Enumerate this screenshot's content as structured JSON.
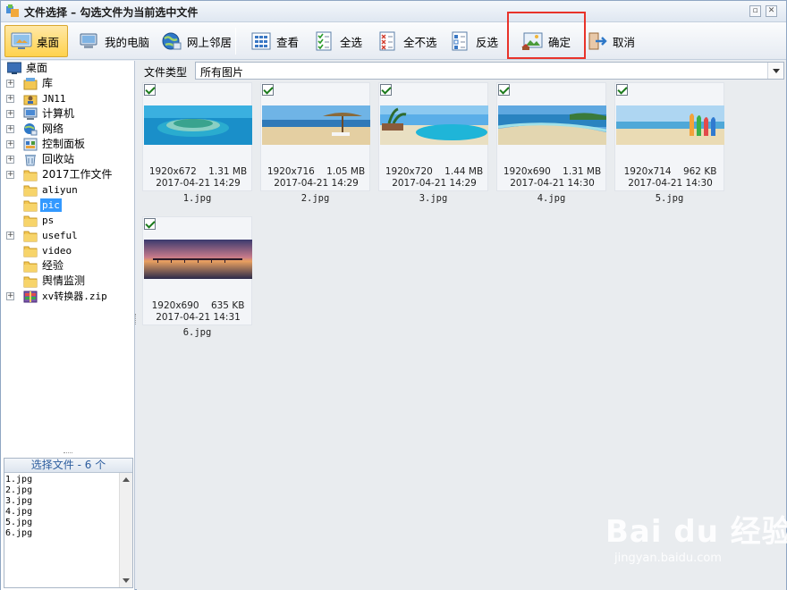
{
  "window": {
    "title": "文件选择 – 勾选文件为当前选中文件"
  },
  "toolbar": {
    "desktop": "桌面",
    "my_computer": "我的电脑",
    "network": "网上邻居",
    "view": "查看",
    "select_all": "全选",
    "select_none": "全不选",
    "invert": "反选",
    "confirm": "确定",
    "cancel": "取消"
  },
  "tree": {
    "root": "桌面",
    "items": [
      {
        "label": "库",
        "expandable": true,
        "icon": "library-icon"
      },
      {
        "label": "JN11",
        "expandable": true,
        "icon": "user-folder-icon"
      },
      {
        "label": "计算机",
        "expandable": true,
        "icon": "computer-icon"
      },
      {
        "label": "网络",
        "expandable": true,
        "icon": "network-icon"
      },
      {
        "label": "控制面板",
        "expandable": true,
        "icon": "control-panel-icon"
      },
      {
        "label": "回收站",
        "expandable": true,
        "icon": "recycle-bin-icon"
      },
      {
        "label": "2017工作文件",
        "expandable": true,
        "icon": "folder-icon"
      },
      {
        "label": "aliyun",
        "expandable": false,
        "icon": "folder-icon"
      },
      {
        "label": "pic",
        "expandable": false,
        "icon": "folder-icon",
        "selected": true
      },
      {
        "label": "ps",
        "expandable": false,
        "icon": "folder-icon"
      },
      {
        "label": "useful",
        "expandable": true,
        "icon": "folder-icon"
      },
      {
        "label": "video",
        "expandable": false,
        "icon": "folder-icon"
      },
      {
        "label": "经验",
        "expandable": false,
        "icon": "folder-icon"
      },
      {
        "label": "舆情监测",
        "expandable": false,
        "icon": "folder-icon"
      },
      {
        "label": "xv转换器.zip",
        "expandable": true,
        "icon": "zip-icon"
      }
    ]
  },
  "selection": {
    "header": "选择文件 - 6 个",
    "files": [
      "1.jpg",
      "2.jpg",
      "3.jpg",
      "4.jpg",
      "5.jpg",
      "6.jpg"
    ]
  },
  "filter": {
    "label": "文件类型",
    "value": "所有图片"
  },
  "files": [
    {
      "name": "1.jpg",
      "dims": "1920x672",
      "size": "1.31 MB",
      "date": "2017-04-21 14:29",
      "checked": true,
      "scene": "island"
    },
    {
      "name": "2.jpg",
      "dims": "1920x716",
      "size": "1.05 MB",
      "date": "2017-04-21 14:29",
      "checked": true,
      "scene": "umbrella"
    },
    {
      "name": "3.jpg",
      "dims": "1920x720",
      "size": "1.44 MB",
      "date": "2017-04-21 14:29",
      "checked": true,
      "scene": "pool"
    },
    {
      "name": "4.jpg",
      "dims": "1920x690",
      "size": "1.31 MB",
      "date": "2017-04-21 14:30",
      "checked": true,
      "scene": "coast"
    },
    {
      "name": "5.jpg",
      "dims": "1920x714",
      "size": "962 KB",
      "date": "2017-04-21 14:30",
      "checked": true,
      "scene": "surfboards"
    },
    {
      "name": "6.jpg",
      "dims": "1920x690",
      "size": "635 KB",
      "date": "2017-04-21 14:31",
      "checked": true,
      "scene": "pier-sunset"
    }
  ],
  "watermark": {
    "logo": "Bai du 经验",
    "url": "jingyan.baidu.com"
  },
  "colors": {
    "accent": "#3399ff",
    "highlight_box": "#e8332a",
    "active_button": "#ffd24d"
  }
}
